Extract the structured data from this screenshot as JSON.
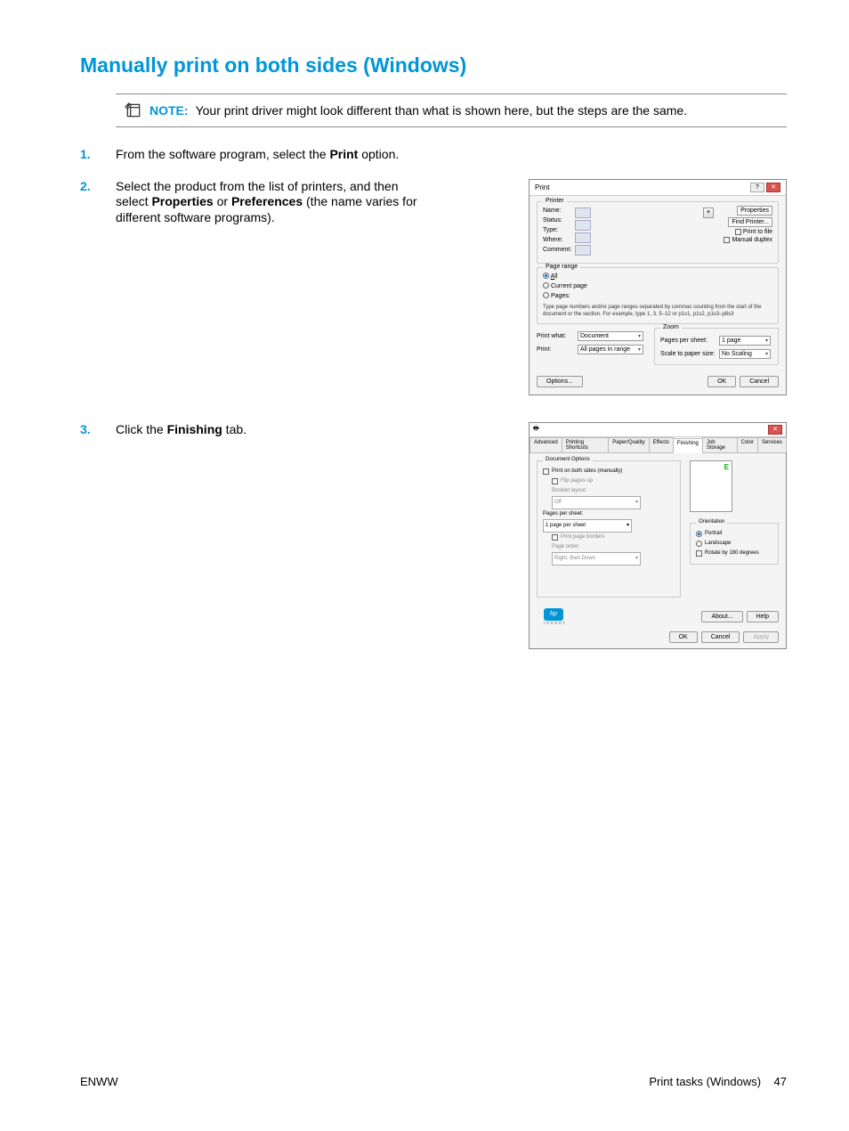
{
  "heading": "Manually print on both sides (Windows)",
  "note": {
    "label": "NOTE:",
    "text": "Your print driver might look different than what is shown here, but the steps are the same."
  },
  "steps": {
    "s1": {
      "num": "1.",
      "text_a": "From the software program, select the ",
      "bold_a": "Print",
      "text_b": " option."
    },
    "s2": {
      "num": "2.",
      "text_a": "Select the product from the list of printers, and then select ",
      "bold_a": "Properties",
      "mid": " or ",
      "bold_b": "Preferences",
      "text_b": " (the name varies for different software programs)."
    },
    "s3": {
      "num": "3.",
      "text_a": "Click the ",
      "bold_a": "Finishing",
      "text_b": " tab."
    }
  },
  "printDlg": {
    "title": "Print",
    "printerGroup": "Printer",
    "nameLabel": "Name:",
    "statusLabel": "Status:",
    "typeLabel": "Type:",
    "whereLabel": "Where:",
    "commentLabel": "Comment:",
    "propertiesBtn": "Properties",
    "findPrinterBtn": "Find Printer...",
    "printToFile": "Print to file",
    "manualDuplex": "Manual duplex",
    "rangeGroup": "Page range",
    "all": "All",
    "current": "Current page",
    "pages": "Pages:",
    "rangeHelp1": "Type page numbers and/or page ranges separated by commas counting from the start of the document or the section. For example, type 1, 3, 5–12 or p1s1, p1s2, p1s3–p8s3",
    "printWhatLabel": "Print what:",
    "printWhatVal": "Document",
    "printLabel": "Print:",
    "printVal": "All pages in range",
    "zoomGroup": "Zoom",
    "pagesPerSheet": "Pages per sheet:",
    "pagesPerSheetVal": "1 page",
    "scaleLabel": "Scale to paper size:",
    "scaleVal": "No Scaling",
    "optionsBtn": "Options...",
    "okBtn": "OK",
    "cancelBtn": "Cancel"
  },
  "propsDlg": {
    "tabs": [
      "Advanced",
      "Printing Shortcuts",
      "Paper/Quality",
      "Effects",
      "Finishing",
      "Job Storage",
      "Color",
      "Services"
    ],
    "docOptions": "Document Options",
    "printBoth": "Print on both sides (manually)",
    "flipUp": "Flip pages up",
    "bookletLabel": "Booklet layout:",
    "bookletVal": "Off",
    "ppsLabel": "Pages per sheet:",
    "ppsVal": "1 page per sheet",
    "printBorders": "Print page borders",
    "pageOrderLabel": "Page order:",
    "pageOrderVal": "Right, then Down",
    "orientGroup": "Orientation",
    "portrait": "Portrait",
    "landscape": "Landscape",
    "rotate": "Rotate by 180 degrees",
    "aboutBtn": "About...",
    "helpBtn": "Help",
    "okBtn": "OK",
    "cancelBtn": "Cancel",
    "applyBtn": "Apply",
    "invent": "invent"
  },
  "footer": {
    "left": "ENWW",
    "rightLabel": "Print tasks (Windows)",
    "pageNum": "47"
  }
}
